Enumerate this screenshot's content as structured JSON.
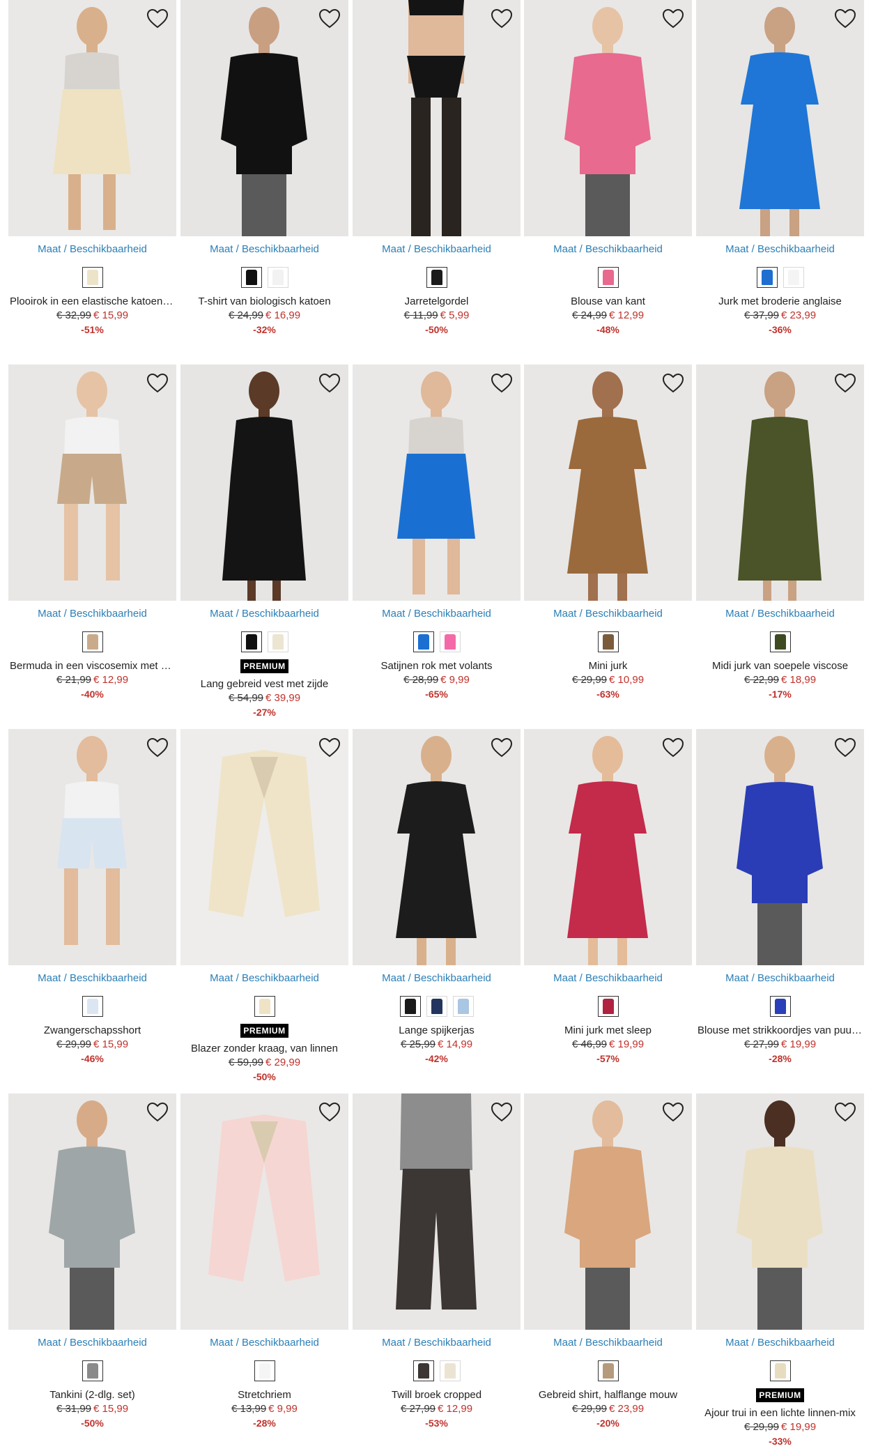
{
  "size_link_label": "Maat / Beschikbaarheid",
  "premium_label": "PREMIUM",
  "colors": {
    "link": "#2b7fb6",
    "sale": "#c0312b"
  },
  "products": [
    {
      "title": "Plooirok in een elastische katoenmix",
      "old_price": "€ 32,99",
      "new_price": "€ 15,99",
      "discount": "-51%",
      "premium": false,
      "swatches": [
        "#ede3c8"
      ],
      "image": {
        "bg": "#e9e8e6",
        "garment": "#eee2c2",
        "skin": "#d9b08c",
        "type": "skirt"
      }
    },
    {
      "title": "T-shirt van biologisch katoen",
      "old_price": "€ 24,99",
      "new_price": "€ 16,99",
      "discount": "-32%",
      "premium": false,
      "swatches": [
        "#111111",
        "#f2f2f2"
      ],
      "image": {
        "bg": "#e6e5e3",
        "garment": "#111111",
        "skin": "#c99f82",
        "type": "top"
      }
    },
    {
      "title": "Jarretelgordel",
      "old_price": "€ 11,99",
      "new_price": "€ 5,99",
      "discount": "-50%",
      "premium": false,
      "swatches": [
        "#1b1b1b"
      ],
      "image": {
        "bg": "#e8e7e5",
        "garment": "#141414",
        "skin": "#e0b89a",
        "type": "lingerie"
      }
    },
    {
      "title": "Blouse van kant",
      "old_price": "€ 24,99",
      "new_price": "€ 12,99",
      "discount": "-48%",
      "premium": false,
      "swatches": [
        "#e86a8e"
      ],
      "image": {
        "bg": "#e8e7e5",
        "garment": "#e86a8e",
        "skin": "#e7c3a5",
        "type": "top"
      }
    },
    {
      "title": "Jurk met broderie anglaise",
      "old_price": "€ 37,99",
      "new_price": "€ 23,99",
      "discount": "-36%",
      "premium": false,
      "swatches": [
        "#1e6fd0",
        "#f4f4f4"
      ],
      "image": {
        "bg": "#e7e6e4",
        "garment": "#1f76d6",
        "skin": "#c9a183",
        "type": "dress"
      }
    },
    {
      "title": "Bermuda in een viscosemix met ee...",
      "old_price": "€ 21,99",
      "new_price": "€ 12,99",
      "discount": "-40%",
      "premium": false,
      "swatches": [
        "#c9ab8c"
      ],
      "image": {
        "bg": "#e8e7e5",
        "garment": "#c8aa8a",
        "skin": "#e6c3a4",
        "type": "shorts"
      }
    },
    {
      "title": "Lang gebreid vest met zijde",
      "old_price": "€ 54,99",
      "new_price": "€ 39,99",
      "discount": "-27%",
      "premium": true,
      "swatches": [
        "#111111",
        "#ece5d2"
      ],
      "image": {
        "bg": "#e6e5e3",
        "garment": "#141414",
        "skin": "#5b3a28",
        "type": "longdress"
      }
    },
    {
      "title": "Satijnen rok met volants",
      "old_price": "€ 28,99",
      "new_price": "€ 9,99",
      "discount": "-65%",
      "premium": false,
      "swatches": [
        "#1b6fd1",
        "#f46aa9"
      ],
      "image": {
        "bg": "#e9e8e6",
        "garment": "#1a70d2",
        "skin": "#e0b89a",
        "type": "skirt"
      }
    },
    {
      "title": "Mini jurk",
      "old_price": "€ 29,99",
      "new_price": "€ 10,99",
      "discount": "-63%",
      "premium": false,
      "swatches": [
        "#7a5b3c"
      ],
      "image": {
        "bg": "#e8e7e5",
        "garment": "#9a6a3c",
        "skin": "#a1704f",
        "type": "dress"
      }
    },
    {
      "title": "Midi jurk van soepele viscose",
      "old_price": "€ 22,99",
      "new_price": "€ 18,99",
      "discount": "-17%",
      "premium": false,
      "swatches": [
        "#3e4a22"
      ],
      "image": {
        "bg": "#e7e6e4",
        "garment": "#4a5428",
        "skin": "#c9a183",
        "type": "longdress"
      }
    },
    {
      "title": "Zwangerschapsshort",
      "old_price": "€ 29,99",
      "new_price": "€ 15,99",
      "discount": "-46%",
      "premium": false,
      "swatches": [
        "#dbe6f2"
      ],
      "image": {
        "bg": "#e8e7e5",
        "garment": "#d9e4f1",
        "skin": "#e2bc9c",
        "type": "shorts"
      }
    },
    {
      "title": "Blazer zonder kraag, van linnen",
      "old_price": "€ 59,99",
      "new_price": "€ 29,99",
      "discount": "-50%",
      "premium": true,
      "swatches": [
        "#efe3c6"
      ],
      "image": {
        "bg": "#eeedeb",
        "garment": "#efe4c8",
        "skin": "#eeedeb",
        "type": "blazer"
      }
    },
    {
      "title": "Lange spijkerjas",
      "old_price": "€ 25,99",
      "new_price": "€ 14,99",
      "discount": "-42%",
      "premium": false,
      "swatches": [
        "#1a1a1a",
        "#23345e",
        "#a9c6e3"
      ],
      "image": {
        "bg": "#e8e7e5",
        "garment": "#1c1c1c",
        "skin": "#d9b08c",
        "type": "dress"
      }
    },
    {
      "title": "Mini jurk met sleep",
      "old_price": "€ 46,99",
      "new_price": "€ 19,99",
      "discount": "-57%",
      "premium": false,
      "swatches": [
        "#b0223f"
      ],
      "image": {
        "bg": "#e8e7e5",
        "garment": "#c42a4a",
        "skin": "#e4bc9a",
        "type": "dress"
      }
    },
    {
      "title": "Blouse met strikkoordjes van puur ...",
      "old_price": "€ 27,99",
      "new_price": "€ 19,99",
      "discount": "-28%",
      "premium": false,
      "swatches": [
        "#2a3fb8"
      ],
      "image": {
        "bg": "#e7e6e4",
        "garment": "#2a3db6",
        "skin": "#d9b08c",
        "type": "top"
      }
    },
    {
      "title": "Tankini (2-dlg. set)",
      "old_price": "€ 31,99",
      "new_price": "€ 15,99",
      "discount": "-50%",
      "premium": false,
      "swatches": [
        "#8a8a8a"
      ],
      "image": {
        "bg": "#e8e7e5",
        "garment": "#9ea6a8",
        "skin": "#d7ab88",
        "type": "top"
      }
    },
    {
      "title": "Stretchriem",
      "old_price": "€ 13,99",
      "new_price": "€ 9,99",
      "discount": "-28%",
      "premium": false,
      "swatches": [
        "#f5f5f5"
      ],
      "image": {
        "bg": "#e9e8e6",
        "garment": "#f6d6d2",
        "skin": "#e7c3a5",
        "type": "blazer"
      }
    },
    {
      "title": "Twill broek cropped",
      "old_price": "€ 27,99",
      "new_price": "€ 12,99",
      "discount": "-53%",
      "premium": false,
      "swatches": [
        "#3c3734",
        "#ece4d2"
      ],
      "image": {
        "bg": "#e8e7e5",
        "garment": "#3c3734",
        "skin": "#cfcfcf",
        "type": "pants"
      }
    },
    {
      "title": "Gebreid shirt, halflange mouw",
      "old_price": "€ 29,99",
      "new_price": "€ 23,99",
      "discount": "-20%",
      "premium": false,
      "swatches": [
        "#b59a7c"
      ],
      "image": {
        "bg": "#e8e7e5",
        "garment": "#d9a67e",
        "skin": "#e2bc9c",
        "type": "top"
      }
    },
    {
      "title": "Ajour trui in een lichte linnen-mix",
      "old_price": "€ 29,99",
      "new_price": "€ 19,99",
      "discount": "-33%",
      "premium": true,
      "swatches": [
        "#e8dcc0"
      ],
      "image": {
        "bg": "#e7e6e4",
        "garment": "#eadfc3",
        "skin": "#4a2f22",
        "type": "top"
      }
    }
  ]
}
